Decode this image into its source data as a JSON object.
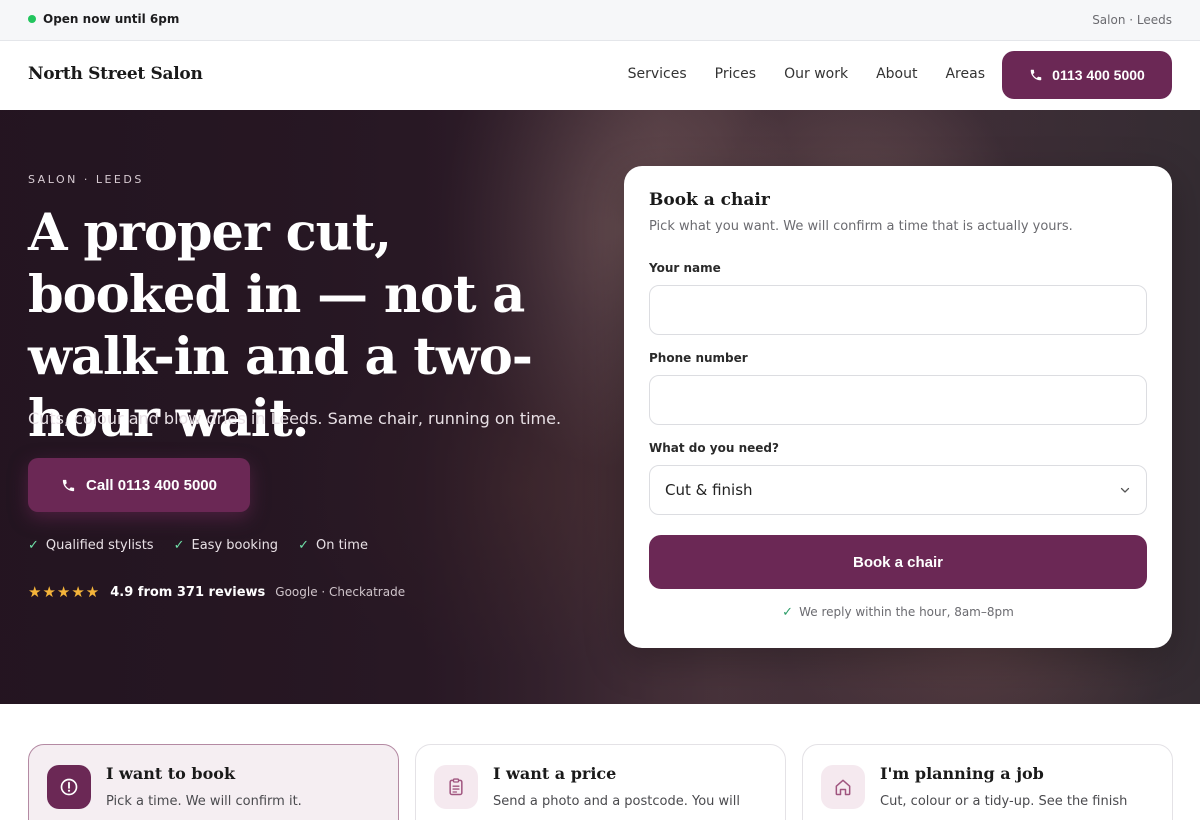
{
  "topbar": {
    "status": "Open now until 6pm",
    "location": "Salon · Leeds"
  },
  "header": {
    "brand": "North Street Salon",
    "nav": [
      "Services",
      "Prices",
      "Our work",
      "About",
      "Areas"
    ],
    "phone_button": "0113 400 5000"
  },
  "hero": {
    "eyebrow": "SALON · LEEDS",
    "headline": "A proper cut, booked in — not a walk-in and a two-hour wait.",
    "subline": "Cuts, colour and blow dries in Leeds. Same chair, running on time.",
    "call_button": "Call 0113 400 5000",
    "checks": [
      "Qualified stylists",
      "Easy booking",
      "On time"
    ],
    "rating": {
      "stars": "★★★★★",
      "score": "4.9 from 371 reviews",
      "sources": "Google · Checkatrade"
    }
  },
  "booking": {
    "title": "Book a chair",
    "description": "Pick what you want. We will confirm a time that is actually yours.",
    "name_label": "Your name",
    "name_value": "",
    "phone_label": "Phone number",
    "phone_value": "",
    "need_label": "What do you need?",
    "need_selected": "Cut & finish",
    "submit": "Book a chair",
    "reply_note": "We reply within the hour, 8am–8pm"
  },
  "options": [
    {
      "title": "I want to book",
      "text": "Pick a time. We will confirm it.",
      "icon": "alert-circle-icon",
      "active": true
    },
    {
      "title": "I want a price",
      "text": "Send a photo and a postcode. You will",
      "icon": "clipboard-icon",
      "active": false
    },
    {
      "title": "I'm planning a job",
      "text": "Cut, colour or a tidy-up. See the finish",
      "icon": "house-icon",
      "active": false
    }
  ],
  "colors": {
    "brand": "#6b2855",
    "status_green": "#22c55e",
    "star": "#f4b43a"
  }
}
